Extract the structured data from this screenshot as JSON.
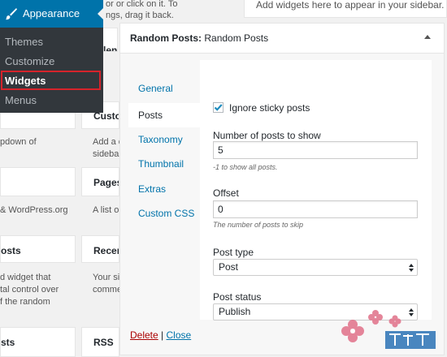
{
  "admin_menu": {
    "section_label": "Appearance",
    "items": [
      {
        "label": "Themes"
      },
      {
        "label": "Customize"
      },
      {
        "label": "Widgets"
      },
      {
        "label": "Menus"
      }
    ]
  },
  "background": {
    "top_text_1": "or or click on it. To",
    "top_text_2": "ngs, drag it back.",
    "top_right_text": "Add widgets here to appear in your sidebar.",
    "partial_title_1": "len",
    "cards": [
      {
        "title": "Custo",
        "desc": "Add a cu\nsideba"
      },
      {
        "title": "Pages",
        "desc": "A list o"
      },
      {
        "title": "osts",
        "desc": ""
      },
      {
        "title": "Recer",
        "desc": "Your si\ncomme"
      },
      {
        "title": "sts",
        "desc": ""
      },
      {
        "title": "RSS",
        "desc": ""
      }
    ],
    "left_texts": {
      "t1": "pdown of",
      "t2": "& WordPress.org",
      "t3": "d widget that\ntal control over\nf the random"
    }
  },
  "widget": {
    "title_bold": "Random Posts:",
    "title_rest": "Random Posts",
    "tabs": [
      {
        "label": "General"
      },
      {
        "label": "Posts"
      },
      {
        "label": "Taxonomy"
      },
      {
        "label": "Thumbnail"
      },
      {
        "label": "Extras"
      },
      {
        "label": "Custom CSS"
      }
    ],
    "active_tab": "Posts",
    "ignore_sticky_label": "Ignore sticky posts",
    "ignore_sticky_checked": true,
    "num_posts_label": "Number of posts to show",
    "num_posts_value": "5",
    "num_posts_hint": "-1 to show all posts.",
    "offset_label": "Offset",
    "offset_value": "0",
    "offset_hint": "The number of posts to skip",
    "post_type_label": "Post type",
    "post_type_value": "Post",
    "post_status_label": "Post status",
    "post_status_value": "Publish",
    "delete_label": "Delete",
    "separator": "|",
    "close_label": "Close"
  },
  "colors": {
    "accent": "#0073aa",
    "admin_bg": "#23282d",
    "highlight": "#d6232b",
    "delete": "#a00000"
  }
}
